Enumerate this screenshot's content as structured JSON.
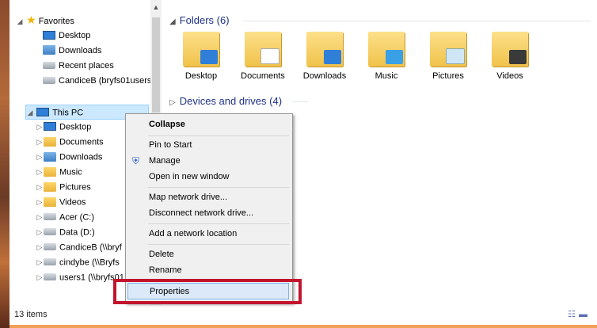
{
  "nav": {
    "favorites_label": "Favorites",
    "favorites_items": [
      "Desktop",
      "Downloads",
      "Recent places",
      "CandiceB (bryfs01users"
    ],
    "thispc_label": "This PC",
    "thispc_items": [
      "Desktop",
      "Documents",
      "Downloads",
      "Music",
      "Pictures",
      "Videos",
      "Acer (C:)",
      "Data (D:)",
      "CandiceB (\\\\bryf",
      "cindybe (\\\\Bryfs",
      "users1 (\\\\bryfs01"
    ]
  },
  "content": {
    "folders_header": "Folders (6)",
    "folders": [
      "Desktop",
      "Documents",
      "Downloads",
      "Music",
      "Pictures",
      "Videos"
    ],
    "devices_header": "Devices and drives (4)"
  },
  "context_menu": {
    "collapse": "Collapse",
    "pin_to_start": "Pin to Start",
    "manage": "Manage",
    "open_new_window": "Open in new window",
    "map_network_drive": "Map network drive...",
    "disconnect_network_drive": "Disconnect network drive...",
    "add_network_location": "Add a network location",
    "delete": "Delete",
    "rename": "Rename",
    "properties": "Properties"
  },
  "status": {
    "items": "13 items"
  },
  "colors": {
    "accent": "#c3142d",
    "selection": "#cce8ff",
    "header_text": "#1e3287"
  }
}
